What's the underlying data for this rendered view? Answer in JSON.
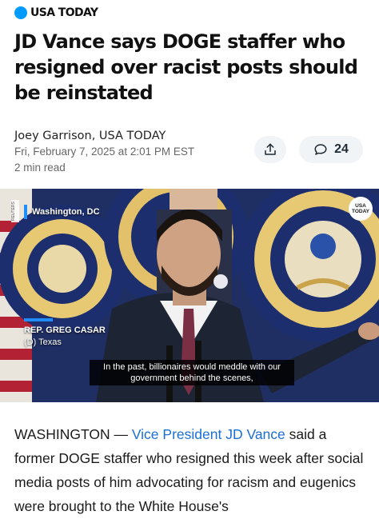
{
  "brand": {
    "name": "USA TODAY",
    "accent": "#009bff"
  },
  "article": {
    "headline": "JD Vance says DOGE staffer who resigned over racist posts should be reinstated",
    "author": "Joey Garrison, USA TODAY",
    "date": "Fri, February 7, 2025 at 2:01 PM EST",
    "read_time": "2 min read",
    "share_icon": "share-icon",
    "comments": {
      "icon": "comment-bubble-icon",
      "count": "24"
    }
  },
  "video": {
    "source_tag": "REUTERS",
    "dateline": "Washington, DC",
    "bug": "USA TODAY",
    "speaker_name": "REP. GREG CASAR",
    "speaker_title": "(D) Texas",
    "caption": "In the past, billionaires would meddle with our government behind the scenes,"
  },
  "body": {
    "dateline": "WASHINGTON — ",
    "link_text": "Vice President JD Vance",
    "text": " said a former DOGE staffer who resigned this week after social media posts of him advocating for racism and eugenics were brought to the White House's",
    "link_color": "#1a6fd6"
  }
}
